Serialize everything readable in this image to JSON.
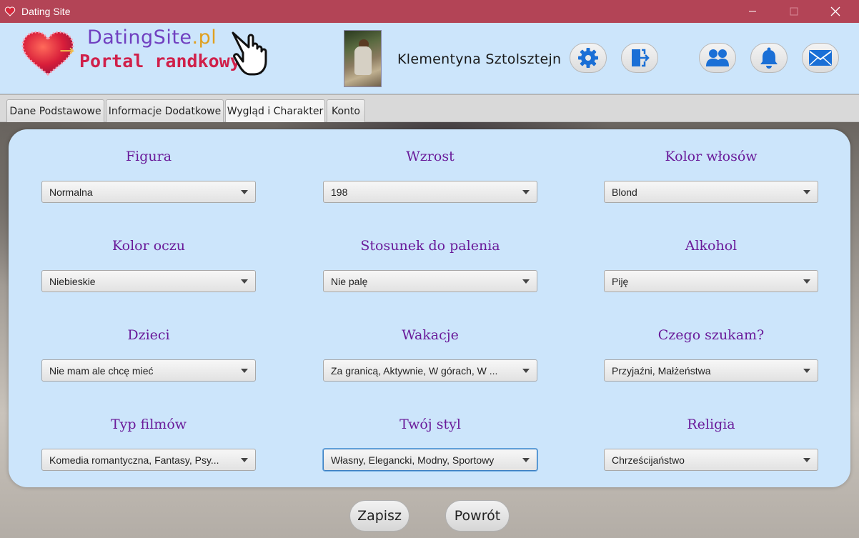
{
  "window": {
    "title": "Dating Site"
  },
  "header": {
    "logo_site": "DatingSite",
    "logo_tld": ".pl",
    "logo_tagline": "Portal randkowy",
    "username": "Klementyna Sztolsztejn"
  },
  "tabs": [
    {
      "label": "Dane Podstawowe"
    },
    {
      "label": "Informacje Dodatkowe"
    },
    {
      "label": "Wygląd i Charakter"
    },
    {
      "label": "Konto"
    }
  ],
  "fields": {
    "figura": {
      "label": "Figura",
      "value": "Normalna"
    },
    "wzrost": {
      "label": "Wzrost",
      "value": "198"
    },
    "kolor_wlosow": {
      "label": "Kolor włosów",
      "value": "Blond"
    },
    "kolor_oczu": {
      "label": "Kolor oczu",
      "value": "Niebieskie"
    },
    "palenie": {
      "label": "Stosunek do palenia",
      "value": "Nie palę"
    },
    "alkohol": {
      "label": "Alkohol",
      "value": "Piję"
    },
    "dzieci": {
      "label": "Dzieci",
      "value": "Nie mam ale chcę mieć"
    },
    "wakacje": {
      "label": "Wakacje",
      "value": "Za granicą, Aktywnie, W górach, W ..."
    },
    "czego_szukam": {
      "label": "Czego szukam?",
      "value": "Przyjaźni, Małżeństwa"
    },
    "typ_filmow": {
      "label": "Typ filmów",
      "value": "Komedia romantyczna, Fantasy, Psy..."
    },
    "styl": {
      "label": "Twój styl",
      "value": "Własny, Elegancki, Modny, Sportowy"
    },
    "religia": {
      "label": "Religia",
      "value": "Chrześcijaństwo"
    }
  },
  "buttons": {
    "save": "Zapisz",
    "back": "Powrót"
  },
  "colors": {
    "titlebar": "#b34456",
    "header_bg": "#cce5fb",
    "label_purple": "#6a1b9a",
    "icon_blue": "#1a6fd6"
  },
  "icons": [
    "heart-logo-icon",
    "pointing-hand-icon",
    "gear-icon",
    "logout-icon",
    "users-icon",
    "bell-icon",
    "mail-icon"
  ]
}
